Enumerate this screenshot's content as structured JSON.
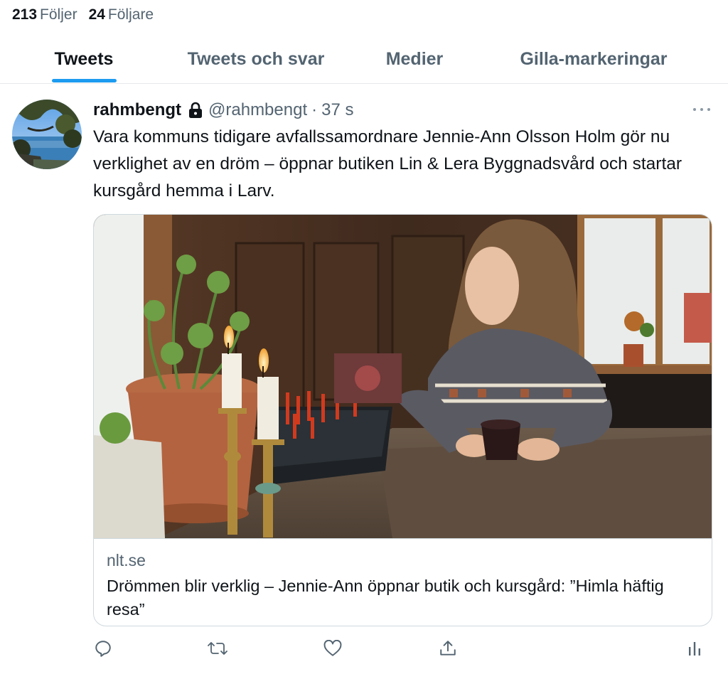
{
  "profile_stats": {
    "following_count": "213",
    "following_label": "Följer",
    "followers_count": "24",
    "followers_label": "Följare"
  },
  "tabs": [
    {
      "label": "Tweets",
      "active": true
    },
    {
      "label": "Tweets och svar",
      "active": false
    },
    {
      "label": "Medier",
      "active": false
    },
    {
      "label": "Gilla-markeringar",
      "active": false
    }
  ],
  "tweet": {
    "display_name": "rahmbengt",
    "protected_icon": "lock-icon",
    "handle": "@rahmbengt",
    "separator": "·",
    "time": "37 s",
    "more_icon": "more-horizontal-icon",
    "text": "Vara kommuns tidigare avfallssamordnare Jennie-Ann Olsson Holm gör nu verklighet av en dröm – öppnar butiken Lin & Lera Byggnadsvård och startar kursgård hemma i Larv.",
    "card": {
      "domain": "nlt.se",
      "title": "Drömmen blir verklig – Jennie-Ann öppnar butik och kursgård: ”Himla häftig resa”"
    },
    "actions": [
      "reply-icon",
      "retweet-icon",
      "like-icon",
      "share-icon",
      "analytics-icon"
    ]
  },
  "colors": {
    "accent": "#1d9bf0",
    "text_primary": "#0f1419",
    "text_secondary": "#536471",
    "border": "#cfd9de"
  }
}
